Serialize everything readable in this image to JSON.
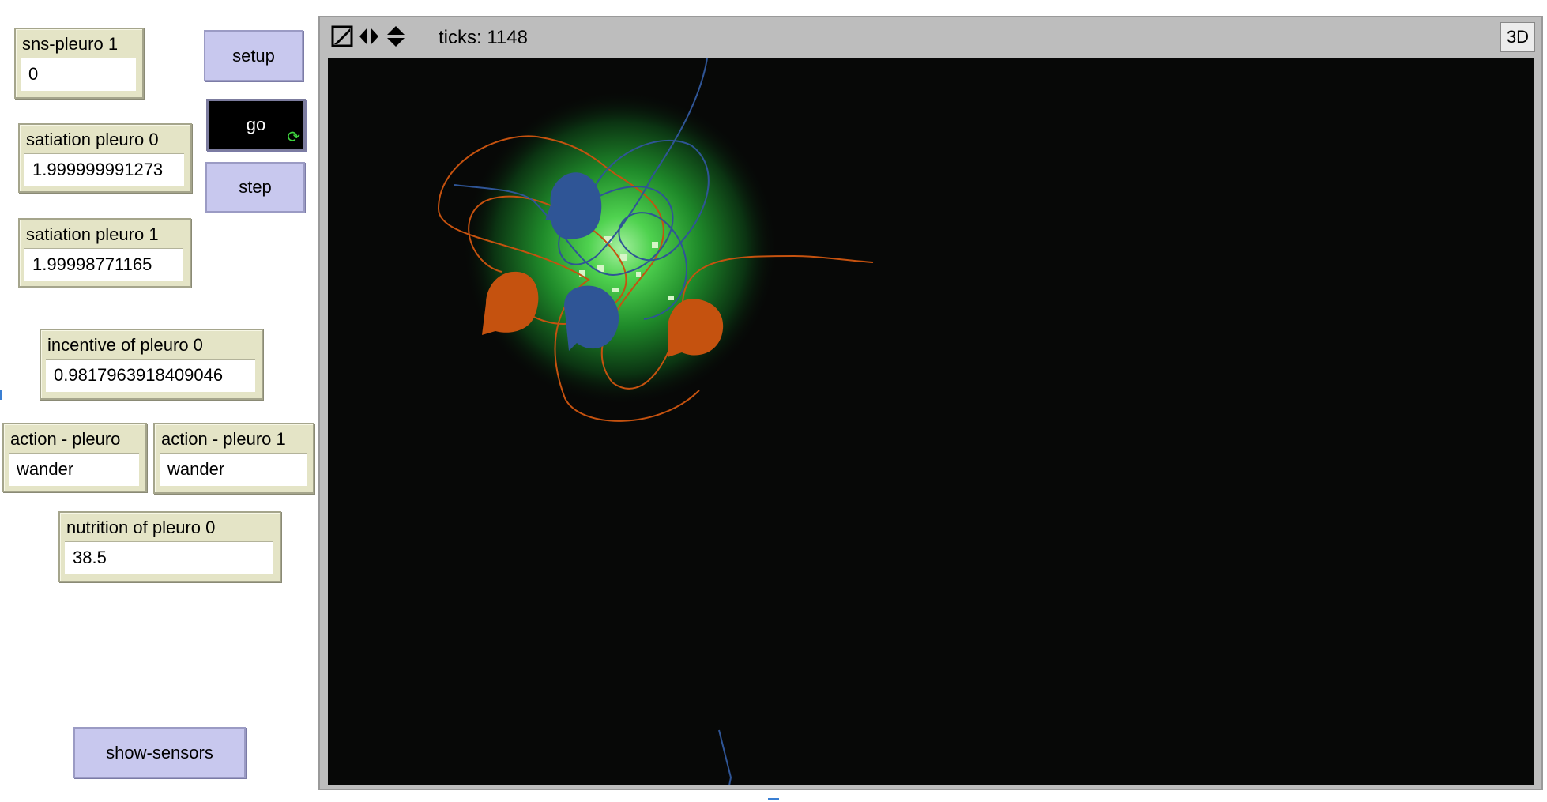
{
  "monitors": {
    "sns_pleuro_1": {
      "label": "sns-pleuro 1",
      "value": "0"
    },
    "satiation_pleuro_0": {
      "label": "satiation pleuro 0",
      "value": "1.999999991273"
    },
    "satiation_pleuro_1": {
      "label": "satiation pleuro 1",
      "value": "1.99998771165"
    },
    "incentive_pleuro_0": {
      "label": "incentive of pleuro 0",
      "value": "0.9817963918409046"
    },
    "action_pleuro_0": {
      "label": "action - pleuro",
      "value": "wander"
    },
    "action_pleuro_1": {
      "label": "action - pleuro 1",
      "value": "wander"
    },
    "nutrition_pleuro_0": {
      "label": "nutrition of pleuro 0",
      "value": "38.5"
    }
  },
  "buttons": {
    "setup": "setup",
    "go": "go",
    "step": "step",
    "show_sensors": "show-sensors"
  },
  "view": {
    "ticks_text": "ticks: 1148",
    "three_d_label": "3D"
  },
  "colors": {
    "world_bg": "#070807",
    "agent_orange": "#c5520f",
    "agent_blue": "#2f5596",
    "patch_green": "#3fd04a",
    "monitor_bg": "#e4e4c6",
    "button_bg": "#c8c8ee"
  },
  "icons": {
    "edit": "pencil-square-icon",
    "horizontal_wrap": "left-right-arrows-icon",
    "vertical_wrap": "up-down-arrows-icon",
    "forever": "forever-refresh-icon"
  }
}
